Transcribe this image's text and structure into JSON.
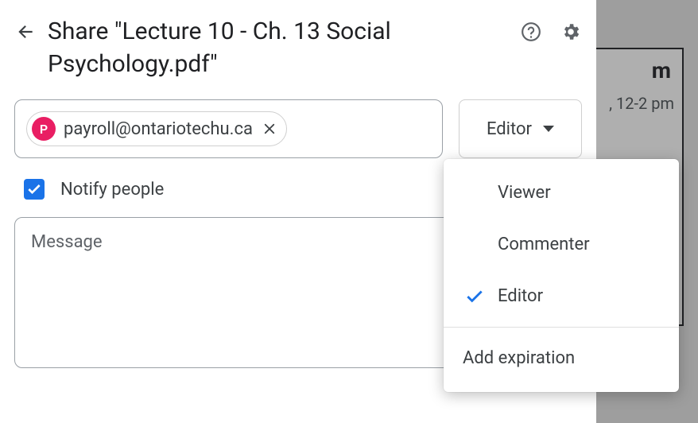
{
  "backdrop": {
    "fragment1": "m",
    "fragment2": ", 12-2 pm"
  },
  "dialog": {
    "title": "Share \"Lecture 10 - Ch. 13 Social Psychology.pdf\"",
    "chip": {
      "initial": "P",
      "email": "payroll@ontariotechu.ca"
    },
    "role_button": "Editor",
    "notify_label": "Notify people",
    "notify_checked": true,
    "message_placeholder": "Message"
  },
  "menu": {
    "items": [
      {
        "label": "Viewer",
        "selected": false
      },
      {
        "label": "Commenter",
        "selected": false
      },
      {
        "label": "Editor",
        "selected": true
      }
    ],
    "footer": "Add expiration"
  }
}
